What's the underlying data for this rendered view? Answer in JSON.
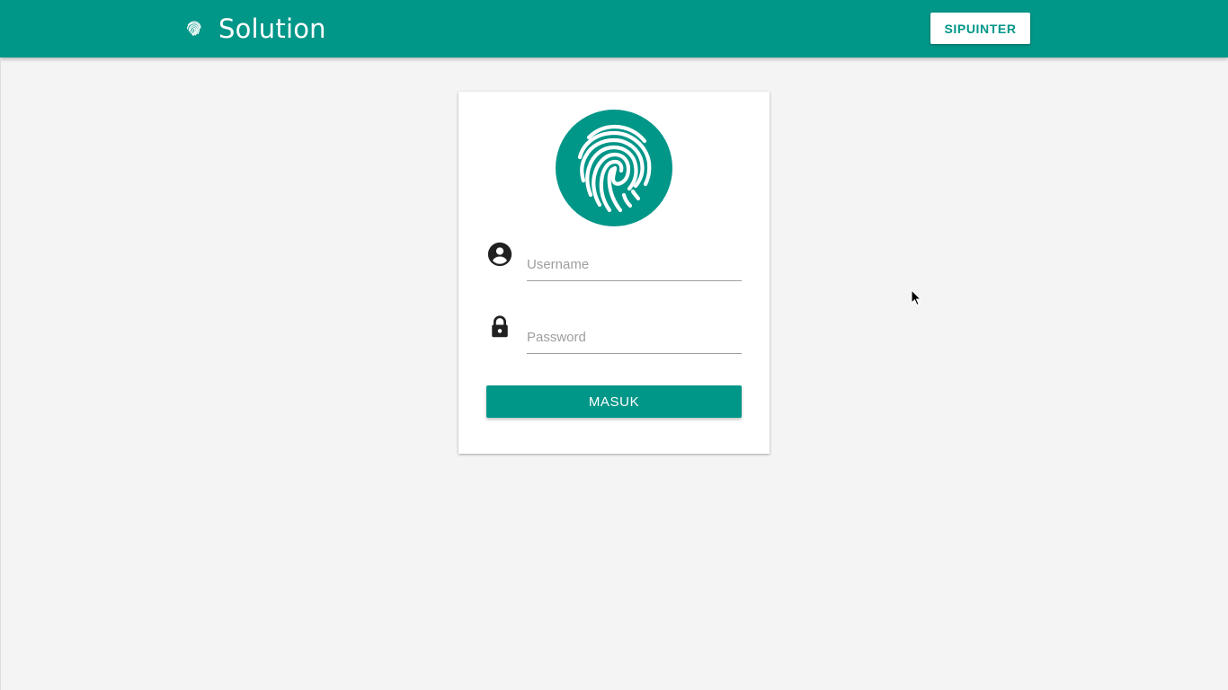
{
  "header": {
    "title": "Solution",
    "brand_icon": "fingerprint-icon",
    "action_button_label": "SIPUINTER"
  },
  "login": {
    "logo_icon": "fingerprint-icon",
    "username": {
      "icon": "account-circle-icon",
      "placeholder": "Username",
      "value": ""
    },
    "password": {
      "icon": "lock-icon",
      "placeholder": "Password",
      "value": ""
    },
    "submit_label": "MASUK"
  },
  "colors": {
    "primary": "#009688",
    "background": "#f4f4f4",
    "card": "#ffffff",
    "icon_dark": "#212121"
  }
}
